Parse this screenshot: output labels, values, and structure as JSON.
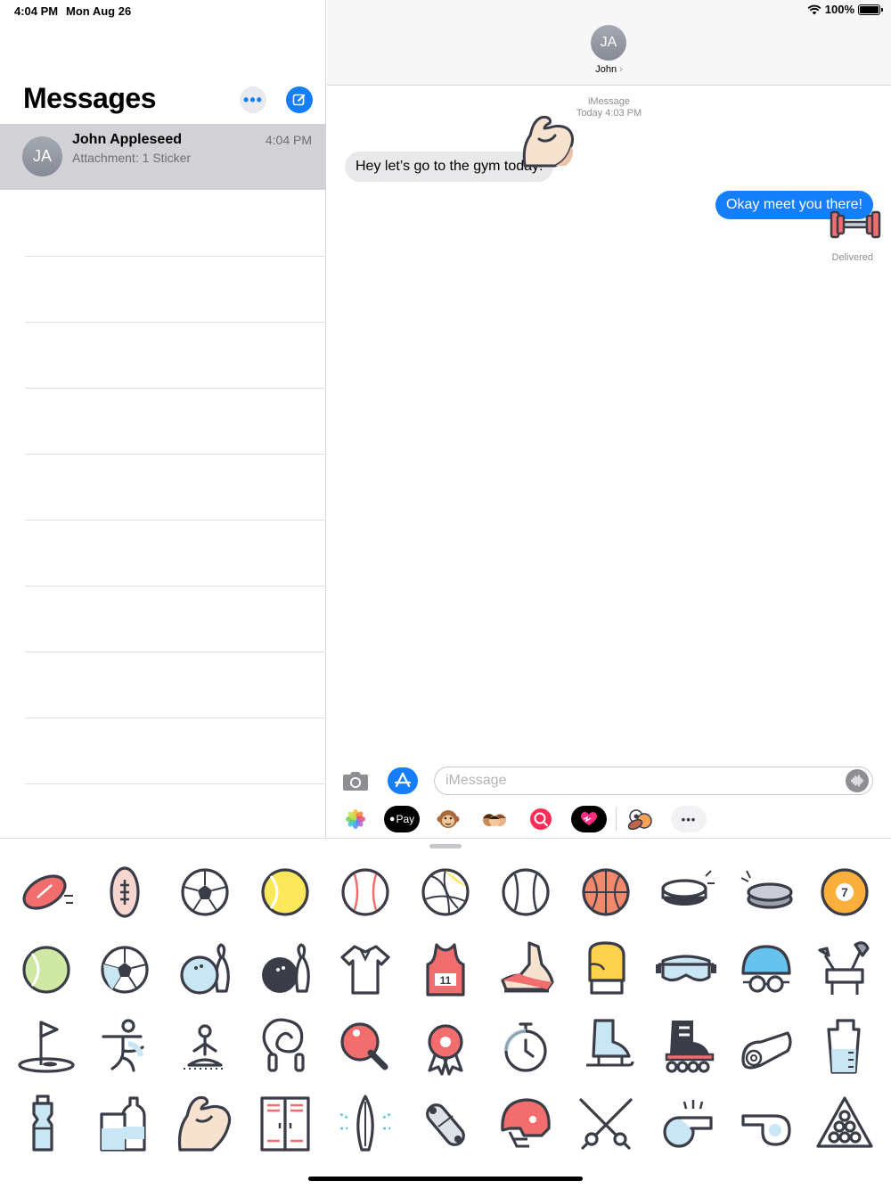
{
  "status_bar": {
    "time": "4:04 PM",
    "date": "Mon Aug 26",
    "battery": "100%"
  },
  "sidebar": {
    "title": "Messages",
    "more_icon": "ellipsis-icon",
    "compose_icon": "compose-icon",
    "conversations": [
      {
        "initials": "JA",
        "name": "John Appleseed",
        "time": "4:04 PM",
        "preview": "Attachment: 1 Sticker"
      }
    ]
  },
  "conversation": {
    "contact_initials": "JA",
    "contact_name": "John",
    "service": "iMessage",
    "timestamp": "Today 4:03 PM",
    "messages": [
      {
        "direction": "incoming",
        "text": "Hey let’s go to the gym today!",
        "sticker": "flexed-biceps-sticker"
      },
      {
        "direction": "outgoing",
        "text": "Okay meet you there!",
        "sticker": "dumbbell-sticker"
      }
    ],
    "delivered_label": "Delivered"
  },
  "input_bar": {
    "placeholder": "iMessage",
    "camera_icon": "camera-icon",
    "appstore_icon": "appstore-icon",
    "audio_icon": "waveform-icon"
  },
  "app_drawer": {
    "apps": [
      "photos",
      "apple-pay",
      "monkey-animoji",
      "memoji",
      "image-search",
      "digital-touch",
      "sports-stickers",
      "more-apps"
    ],
    "apple_pay_label": "Pay"
  },
  "stickers": {
    "row1": [
      "american-football",
      "rugby-ball",
      "soccer-ball",
      "tennis-ball",
      "baseball",
      "volleyball",
      "softball",
      "basketball",
      "hockey-puck",
      "hockey-puck-motion",
      "billiard-ball-7"
    ],
    "row2": [
      "tennis-ball-green",
      "soccer-ball-blue",
      "bowling-ball-pin-blue",
      "bowling-ball-pin-dark",
      "polo-shirt",
      "basketball-jersey-11",
      "running-shoe",
      "boxing-glove",
      "ski-goggles",
      "swim-cap-goggles",
      "golf-clubs-bag"
    ],
    "row3": [
      "golf-flag",
      "gymnast",
      "yoga-pose",
      "jump-rope",
      "ping-pong-paddle",
      "award-ribbon",
      "stopwatch",
      "ice-skate",
      "roller-skate",
      "yoga-mat",
      "shaker-bottle"
    ],
    "row4": [
      "water-bottle",
      "water-bottles",
      "flexed-biceps",
      "lockers",
      "surfboard",
      "skateboard",
      "football-helmet",
      "fencing-swords",
      "whistle",
      "whistle-alt",
      "billiard-rack"
    ],
    "jersey_number": "11",
    "billiard_number": "7",
    "colors": {
      "red": "#f26d6d",
      "yellow": "#fde85b",
      "blue": "#c9e6f5",
      "dark": "#3a3c47",
      "green": "#cfe8a4"
    }
  },
  "theme": {
    "accent": "#147efb",
    "selected_row": "#d1d1d6",
    "incoming_bubble": "#e9e9eb"
  }
}
